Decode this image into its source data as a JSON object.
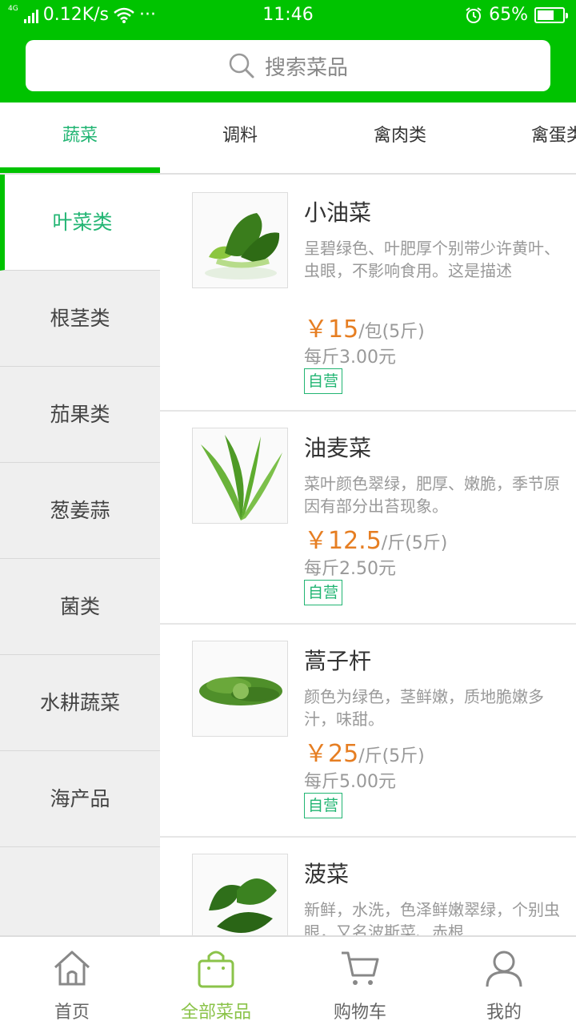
{
  "status_bar": {
    "network_type": "4G",
    "speed": "0.12K/s",
    "more": "···",
    "time": "11:46",
    "battery": "65%",
    "battery_level": 0.65
  },
  "search": {
    "placeholder": "搜索菜品"
  },
  "tabs": [
    {
      "label": "蔬菜",
      "active": true
    },
    {
      "label": "调料",
      "active": false
    },
    {
      "label": "禽肉类",
      "active": false
    },
    {
      "label": "禽蛋类",
      "active": false
    }
  ],
  "sidebar": [
    {
      "label": "叶菜类",
      "active": true
    },
    {
      "label": "根茎类",
      "active": false
    },
    {
      "label": "茄果类",
      "active": false
    },
    {
      "label": "葱姜蒜",
      "active": false
    },
    {
      "label": "菌类",
      "active": false
    },
    {
      "label": "水耕蔬菜",
      "active": false
    },
    {
      "label": "海产品",
      "active": false
    }
  ],
  "products": [
    {
      "name": "小油菜",
      "desc": "呈碧绿色、叶肥厚个别带少许黄叶、虫眼，不影响食用。这是描述",
      "price": "￥15",
      "unit": "/包(5斤)",
      "per_jin": "每斤3.00元",
      "tag": "自营",
      "image_icon": "bok-choy-image"
    },
    {
      "name": "油麦菜",
      "desc": "菜叶颜色翠绿，肥厚、嫩脆，季节原因有部分出苔现象。",
      "price": "￥12.5",
      "unit": "/斤(5斤)",
      "per_jin": "每斤2.50元",
      "tag": "自营",
      "image_icon": "lettuce-image"
    },
    {
      "name": "蒿子杆",
      "desc": "颜色为绿色，茎鲜嫩，质地脆嫩多汁，味甜。",
      "price": "￥25",
      "unit": "/斤(5斤)",
      "per_jin": "每斤5.00元",
      "tag": "自营",
      "image_icon": "crown-daisy-image"
    },
    {
      "name": "菠菜",
      "desc": "新鲜，水洗，色泽鲜嫩翠绿，个别虫眼，又名波斯菜、赤根",
      "image_icon": "spinach-image"
    }
  ],
  "bottom_nav": [
    {
      "label": "首页",
      "icon": "home-icon",
      "active": false
    },
    {
      "label": "全部菜品",
      "icon": "shopping-bag-icon",
      "active": true
    },
    {
      "label": "购物车",
      "icon": "cart-icon",
      "active": false
    },
    {
      "label": "我的",
      "icon": "user-icon",
      "active": false
    }
  ],
  "colors": {
    "header_green": "#00c300",
    "accent_green": "#22b573",
    "price_orange": "#e67e22",
    "nav_active": "#8bc34a"
  }
}
